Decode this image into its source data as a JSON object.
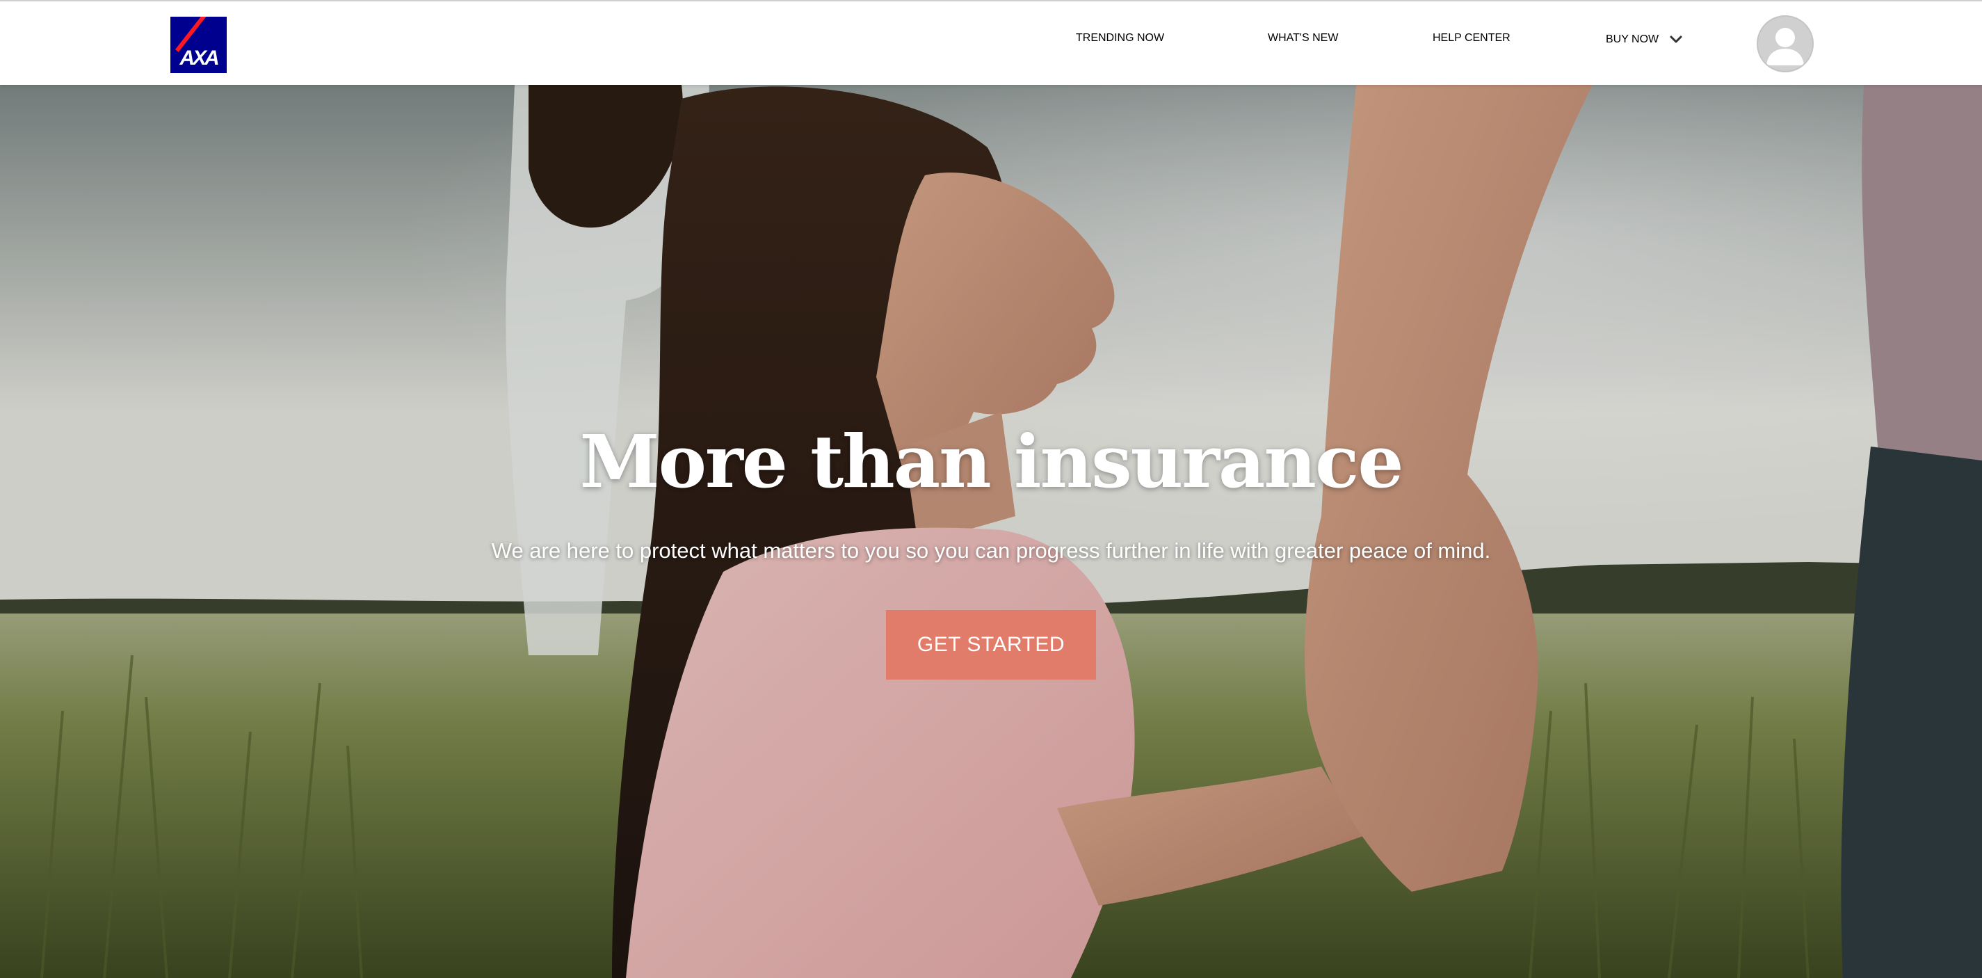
{
  "header": {
    "logo_text": "AXA",
    "nav": [
      {
        "label": "TRENDING NOW"
      },
      {
        "label": "WHAT'S NEW"
      },
      {
        "label": "HELP CENTER"
      },
      {
        "label": "BUY NOW",
        "icon": "chevron-down-icon"
      }
    ],
    "profile_icon": "user-avatar-icon"
  },
  "hero": {
    "title": "More than insurance",
    "subtitle": "We are here to protect what matters to you so you can progress further in life with greater peace of mind.",
    "cta_label": "GET STARTED",
    "background_image": "girl-holding-parent-hand-in-field-photo"
  },
  "colors": {
    "brand_blue": "#00008f",
    "brand_red": "#ff1721",
    "cta": "#e27c6a",
    "nav_text": "#333333"
  }
}
